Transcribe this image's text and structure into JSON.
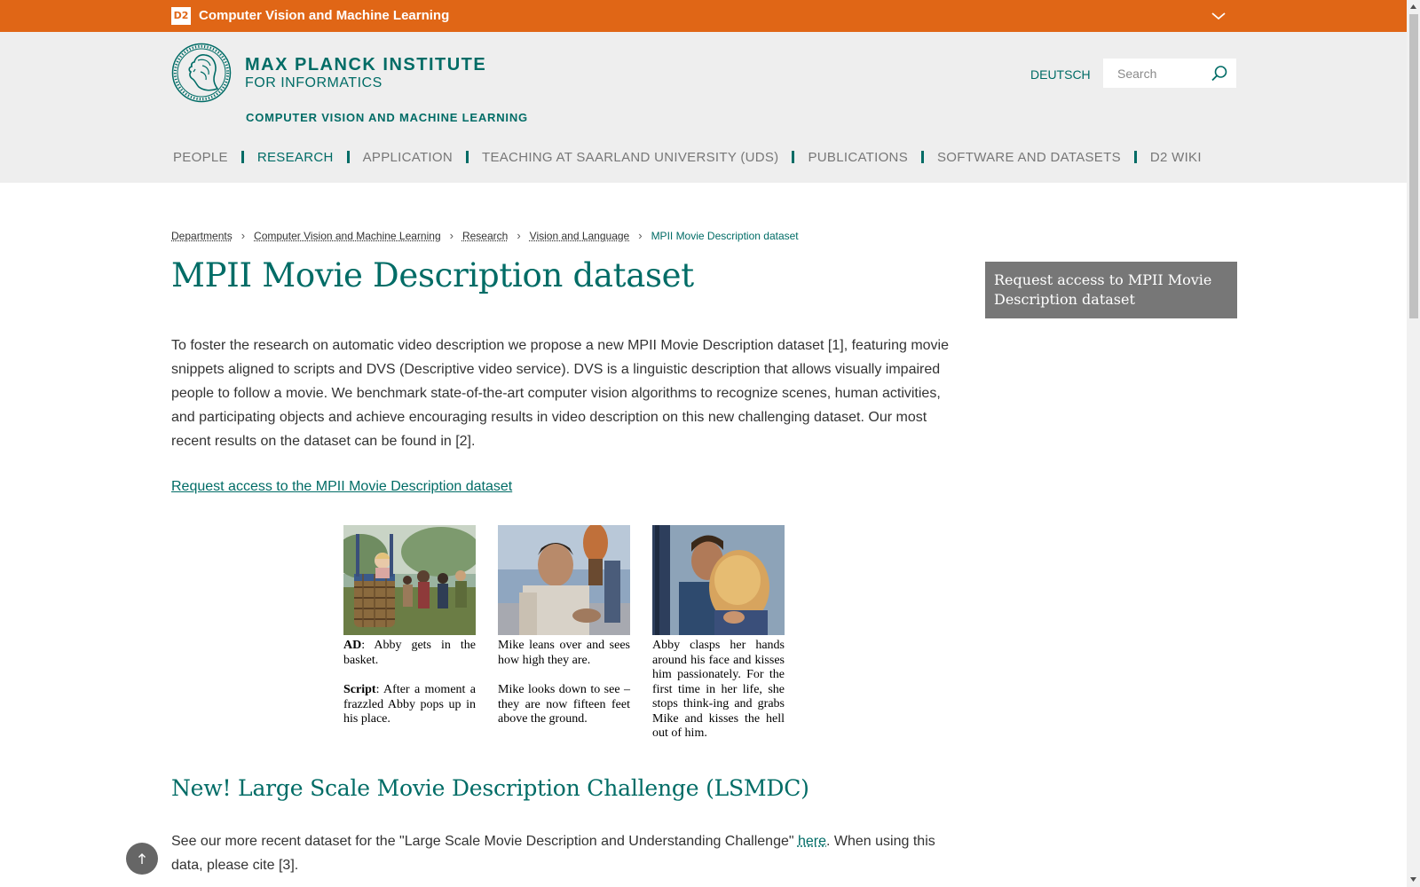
{
  "topbar": {
    "badge": "D2",
    "department": "Computer Vision and Machine Learning"
  },
  "header": {
    "institute_line1": "MAX PLANCK INSTITUTE",
    "institute_line2": "FOR INFORMATICS",
    "department": "COMPUTER VISION AND MACHINE LEARNING",
    "language": "DEUTSCH",
    "search_placeholder": "Search"
  },
  "nav": {
    "items": [
      {
        "label": "PEOPLE",
        "active": false
      },
      {
        "label": "RESEARCH",
        "active": true
      },
      {
        "label": "APPLICATION",
        "active": false
      },
      {
        "label": "TEACHING AT SAARLAND UNIVERSITY (UDS)",
        "active": false
      },
      {
        "label": "PUBLICATIONS",
        "active": false
      },
      {
        "label": "SOFTWARE AND DATASETS",
        "active": false
      },
      {
        "label": "D2 WIKI",
        "active": false
      }
    ]
  },
  "breadcrumb": {
    "items": [
      "Departments",
      "Computer Vision and Machine Learning",
      "Research",
      "Vision and Language"
    ],
    "current": "MPII Movie Description dataset"
  },
  "page_title": "MPII Movie Description dataset",
  "sidebar": {
    "request_box": "Request access to MPII Movie Description dataset"
  },
  "intro": "To foster the research on automatic video description we propose a new MPII Movie Description dataset [1], featuring movie snippets aligned to scripts and DVS (Descriptive video service). DVS is a linguistic description that allows visually impaired people to follow a movie. We benchmark state-of-the-art computer vision algorithms to recognize scenes, human activities, and participating objects and achieve encouraging results in video description on this new challenging dataset. Our most recent results on the dataset can be found in [2].",
  "request_link": "Request access to the MPII Movie Description dataset",
  "figure": {
    "panels": [
      {
        "ad_label": "AD",
        "ad_text": ": Abby gets in the basket.",
        "script_label": "Script",
        "script_text": ": After a moment a frazzled Abby pops up in his place."
      },
      {
        "line1": "Mike leans over and sees how high they are.",
        "line2": "Mike looks down to see – they are now fifteen feet above the ground."
      },
      {
        "line1": "Abby clasps her hands around his face and kisses him passionately. For the first time in her life, she stops think-ing and grabs Mike and kisses the hell out of him."
      }
    ]
  },
  "lsmdc": {
    "heading": "New! Large Scale Movie Description Challenge (LSMDC)",
    "text_before": "See our more recent dataset for the \"Large Scale Movie Description and Understanding Challenge\" ",
    "link": "here",
    "text_after": ". When using this data, please cite [3]."
  },
  "colors": {
    "accent": "#006c66",
    "topbar": "#e06616",
    "header_bg": "#eeeeee",
    "sidebox": "#777777"
  },
  "icons": [
    "chevron-down-icon",
    "search-icon",
    "logo-minerva-icon",
    "breadcrumb-chevron-icon",
    "arrow-up-icon"
  ]
}
